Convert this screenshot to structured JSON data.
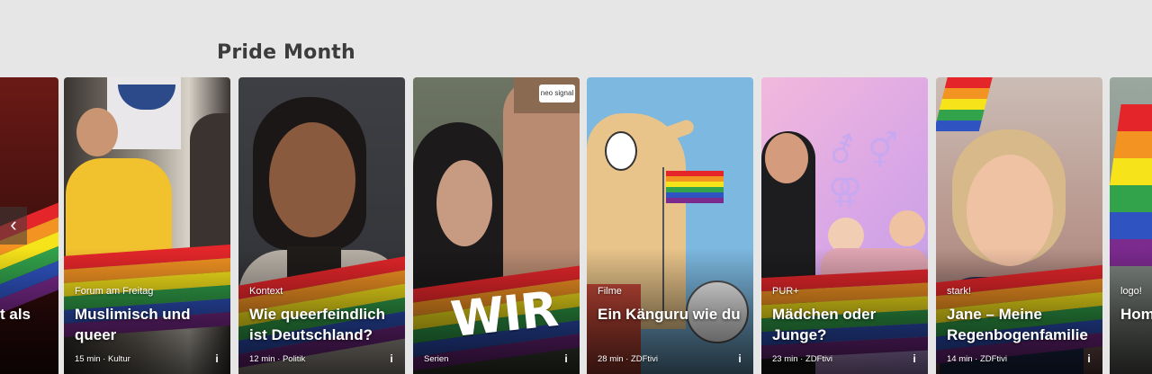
{
  "section": {
    "title": "Pride Month"
  },
  "rail": {
    "prev_icon": "chevron-left-icon",
    "cards": [
      {
        "id": "partial-left",
        "title": "t als",
        "eyebrow": "",
        "meta": ""
      },
      {
        "id": "muslimisch",
        "eyebrow": "Forum am Freitag",
        "title": "Muslimisch und queer",
        "meta": "15 min · Kultur"
      },
      {
        "id": "queerfeindlich",
        "eyebrow": "Kontext",
        "title": "Wie queerfeindlich ist Deutschland?",
        "meta": "12 min · Politik"
      },
      {
        "id": "wir",
        "eyebrow": "",
        "title": "WIR",
        "meta": "Serien",
        "badge": "neo signal"
      },
      {
        "id": "kaenguru",
        "eyebrow": "Filme",
        "title": "Ein Känguru wie du",
        "meta": "28 min · ZDFtivi"
      },
      {
        "id": "maedchen",
        "eyebrow": "PUR+",
        "title": "Mädchen oder Junge?",
        "meta": "23 min · ZDFtivi",
        "symbols": "⚦ ⚥ ⚢"
      },
      {
        "id": "jane",
        "eyebrow": "stark!",
        "title": "Jane – Meine Regenbogenfamilie",
        "meta": "14 min · ZDFtivi"
      },
      {
        "id": "partial-right",
        "eyebrow": "logo!",
        "title": "Hom",
        "meta": ""
      }
    ],
    "info_icon": "info-icon",
    "info_glyph": "i"
  },
  "colors": {
    "rainbow": [
      "#e4262a",
      "#f39322",
      "#f6e31a",
      "#32a34b",
      "#2f53c1",
      "#7b2a8e"
    ],
    "page_bg": "#e6e6e6",
    "title": "#3c3c3c"
  }
}
